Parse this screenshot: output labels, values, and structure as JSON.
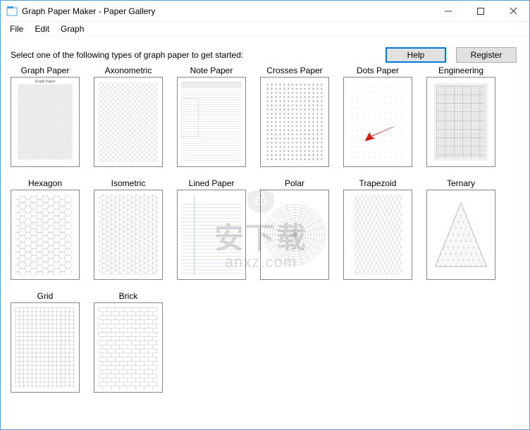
{
  "window": {
    "title": "Graph Paper Maker - Paper Gallery",
    "controls": {
      "minimize": "–",
      "maximize": "□",
      "close": "×"
    }
  },
  "menu": {
    "items": [
      "File",
      "Edit",
      "Graph"
    ]
  },
  "instruction": "Select one of the following types of graph paper to get started:",
  "buttons": {
    "help": "Help",
    "register": "Register"
  },
  "gallery": {
    "items": [
      {
        "label": "Graph Paper",
        "kind": "grid-fine",
        "tinyTitle": "Graph Paper"
      },
      {
        "label": "Axonometric",
        "kind": "axon"
      },
      {
        "label": "Note Paper",
        "kind": "note"
      },
      {
        "label": "Crosses Paper",
        "kind": "crosses"
      },
      {
        "label": "Dots Paper",
        "kind": "dots",
        "arrow": true
      },
      {
        "label": "Engineering",
        "kind": "engineering"
      },
      {
        "label": "Hexagon",
        "kind": "hexagon"
      },
      {
        "label": "Isometric",
        "kind": "isometric"
      },
      {
        "label": "Lined Paper",
        "kind": "lined"
      },
      {
        "label": "Polar",
        "kind": "polar"
      },
      {
        "label": "Trapezoid",
        "kind": "trapezoid"
      },
      {
        "label": "Ternary",
        "kind": "ternary"
      },
      {
        "label": "Grid",
        "kind": "grid"
      },
      {
        "label": "Brick",
        "kind": "brick"
      }
    ]
  },
  "watermark": {
    "chars": "安下载",
    "domain": "anxz.com"
  }
}
